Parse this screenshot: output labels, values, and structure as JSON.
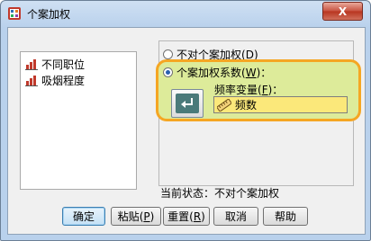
{
  "window": {
    "title": "个案加权",
    "close_label": "X"
  },
  "variables": [
    {
      "label": "不同职位",
      "icon": "scale-variable-icon"
    },
    {
      "label": "吸烟程度",
      "icon": "scale-variable-icon"
    }
  ],
  "options": {
    "no_weight": {
      "label": "不对个案加权",
      "mnemonic": "D",
      "selected": false
    },
    "weight_by": {
      "label": "个案加权系数",
      "mnemonic": "W",
      "suffix": "：",
      "selected": true
    }
  },
  "freq_var": {
    "label": "频率变量",
    "mnemonic": "F",
    "suffix": "：",
    "value": "频数"
  },
  "status": {
    "label": "当前状态：",
    "value": "不对个案加权"
  },
  "buttons": [
    {
      "label": "确定",
      "mnemonic": ""
    },
    {
      "label": "粘贴",
      "mnemonic": "P"
    },
    {
      "label": "重置",
      "mnemonic": "R"
    },
    {
      "label": "取消",
      "mnemonic": ""
    },
    {
      "label": "帮助",
      "mnemonic": ""
    }
  ],
  "colors": {
    "highlight_border": "#f5a623",
    "highlight_fill": "#ddeb9a",
    "field_fill": "#fbe87a"
  }
}
